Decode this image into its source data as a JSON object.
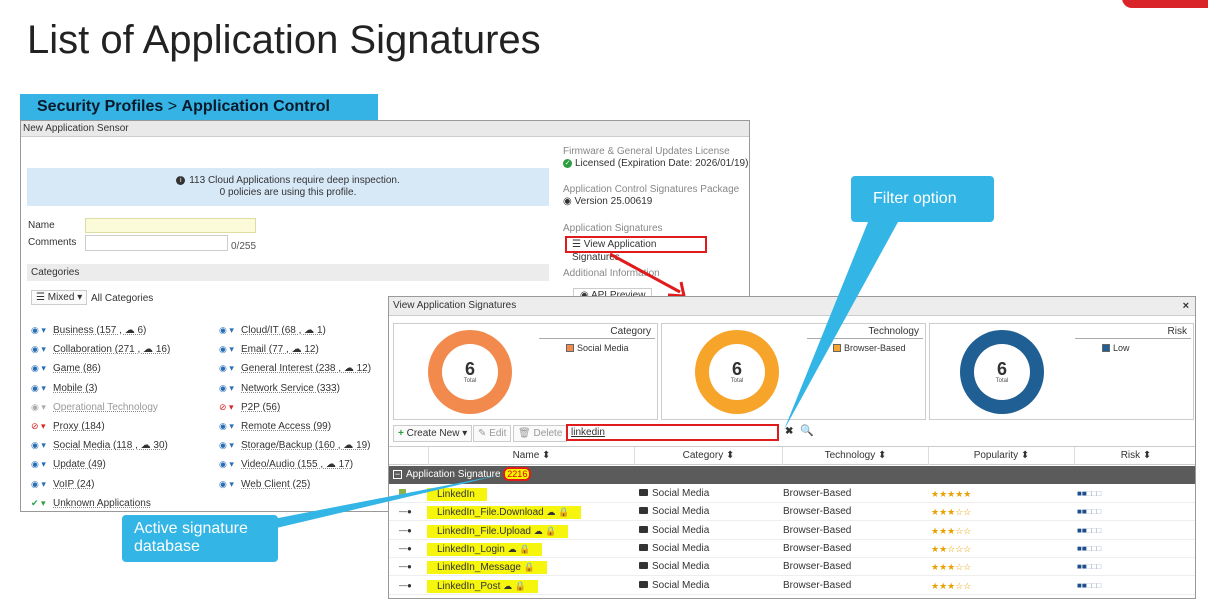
{
  "slide": {
    "title": "List of Application Signatures"
  },
  "banner": {
    "part1": "Security Profiles",
    "sep": " > ",
    "part2": "Application Control"
  },
  "sensor": {
    "window_title": "New Application Sensor",
    "info_line1": "113 Cloud Applications require deep inspection.",
    "info_line2": "0 policies are using this profile.",
    "name_label": "Name",
    "comments_label": "Comments",
    "comments_counter": "0/255",
    "categories_header": "Categories",
    "mixed_label": "Mixed",
    "all_categories": "All Categories",
    "categories_left": [
      {
        "label": "Business (157 , ☁ 6)",
        "state": "monitor"
      },
      {
        "label": "Collaboration (271 , ☁ 16)",
        "state": "monitor"
      },
      {
        "label": "Game (86)",
        "state": "monitor"
      },
      {
        "label": "Mobile (3)",
        "state": "monitor"
      },
      {
        "label": "Operational Technology",
        "state": "disabled"
      },
      {
        "label": "Proxy (184)",
        "state": "block"
      },
      {
        "label": "Social Media (118 , ☁ 30)",
        "state": "monitor"
      },
      {
        "label": "Update (49)",
        "state": "monitor"
      },
      {
        "label": "VoIP (24)",
        "state": "monitor"
      },
      {
        "label": "Unknown Applications",
        "state": "allow"
      }
    ],
    "categories_right": [
      {
        "label": "Cloud/IT (68 , ☁ 1)",
        "state": "monitor"
      },
      {
        "label": "Email (77 , ☁ 12)",
        "state": "monitor"
      },
      {
        "label": "General Interest (238 , ☁ 12)",
        "state": "monitor"
      },
      {
        "label": "Network Service (333)",
        "state": "monitor"
      },
      {
        "label": "P2P (56)",
        "state": "block"
      },
      {
        "label": "Remote Access (99)",
        "state": "monitor"
      },
      {
        "label": "Storage/Backup (160 , ☁ 19)",
        "state": "monitor"
      },
      {
        "label": "Video/Audio (155 , ☁ 17)",
        "state": "monitor"
      },
      {
        "label": "Web Client (25)",
        "state": "monitor"
      }
    ],
    "right": {
      "license_title": "Firmware & General Updates License",
      "license_value": "Licensed (Expiration Date: 2026/01/19)",
      "pkg_title": "Application Control Signatures Package",
      "pkg_value": "Version 25.00619",
      "sig_title": "Application Signatures",
      "view_button": "View Application Signatures",
      "additional": "Additional Information",
      "api_preview": "API Preview"
    }
  },
  "popup": {
    "title": "View Application Signatures",
    "close": "×",
    "panels": [
      {
        "heading": "Category",
        "total": "6",
        "total_label": "Total",
        "legend": "Social Media",
        "color": "#f28a4e"
      },
      {
        "heading": "Technology",
        "total": "6",
        "total_label": "Total",
        "legend": "Browser-Based",
        "color": "#f6a42a"
      },
      {
        "heading": "Risk",
        "total": "6",
        "total_label": "Total",
        "legend": "Low",
        "color": "#1f5f94"
      }
    ],
    "toolbar": {
      "create": "Create New",
      "edit": "Edit",
      "delete": "Delete",
      "search_value": "linkedin"
    },
    "columns": [
      "Name ⬍",
      "Category ⬍",
      "Technology ⬍",
      "Popularity ⬍",
      "Risk ⬍"
    ],
    "group": {
      "label": "Application Signature",
      "count": "2216"
    },
    "rows": [
      {
        "name": "LinkedIn",
        "icons": "",
        "category": "Social Media",
        "technology": "Browser-Based",
        "popularity": 5,
        "risk": 2
      },
      {
        "name": "LinkedIn_File.Download",
        "icons": "☁ 🔒",
        "category": "Social Media",
        "technology": "Browser-Based",
        "popularity": 3,
        "risk": 2
      },
      {
        "name": "LinkedIn_File.Upload",
        "icons": "☁ 🔒",
        "category": "Social Media",
        "technology": "Browser-Based",
        "popularity": 3,
        "risk": 2
      },
      {
        "name": "LinkedIn_Login",
        "icons": "☁ 🔒",
        "category": "Social Media",
        "technology": "Browser-Based",
        "popularity": 2,
        "risk": 2
      },
      {
        "name": "LinkedIn_Message",
        "icons": "🔒",
        "category": "Social Media",
        "technology": "Browser-Based",
        "popularity": 3,
        "risk": 2
      },
      {
        "name": "LinkedIn_Post",
        "icons": "☁ 🔒",
        "category": "Social Media",
        "technology": "Browser-Based",
        "popularity": 3,
        "risk": 2
      }
    ]
  },
  "callouts": {
    "filter": "Filter option",
    "active_db_line1": "Active signature",
    "active_db_line2": "database"
  },
  "colors": {
    "accent_red": "#e01b1b",
    "callout_blue": "#33b5e6",
    "highlight_yellow": "#f6f50e",
    "brand_red": "#d9252a"
  }
}
